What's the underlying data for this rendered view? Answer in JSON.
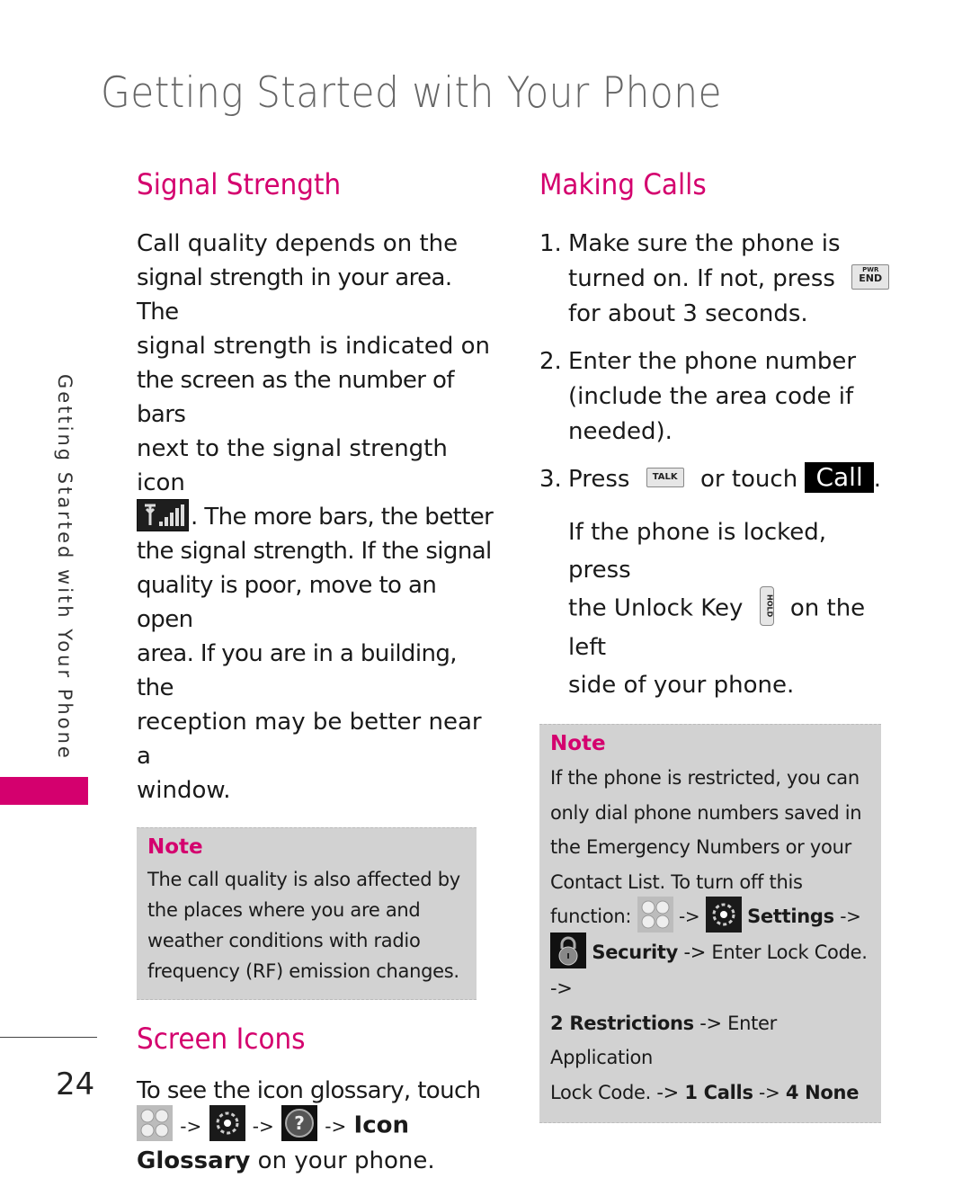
{
  "page": {
    "title": "Getting Started with Your Phone",
    "side_tab": "Getting Started with Your Phone",
    "page_number": "24",
    "accent_color": "#d4006e"
  },
  "signal_strength": {
    "heading": "Signal Strength",
    "lines": [
      "Call quality depends on the",
      "signal strength in your area. The",
      "signal strength is indicated on",
      "the screen as the number of bars",
      "next to the signal strength icon"
    ],
    "icon_line_after": ". The more bars, the better",
    "lines_after": [
      "the signal strength. If the signal",
      "quality is poor, move to an open",
      "area. If you are in a building, the",
      "reception may be better near a",
      "window."
    ],
    "note": {
      "title": "Note",
      "lines": [
        "The call quality is also affected by",
        "the places where you are and",
        "weather conditions with radio",
        "frequency (RF) emission changes."
      ]
    }
  },
  "screen_icons": {
    "heading": "Screen Icons",
    "line1": "To see the icon glossary, touch",
    "arrow": "->",
    "bold_a": "Icon",
    "bold_b": "Glossary",
    "tail": " on your phone."
  },
  "making_calls": {
    "heading": "Making Calls",
    "step1": {
      "num": "1.",
      "line1": "Make sure the phone is",
      "line2": "turned on. If not, press",
      "key_top": "PWR",
      "key_bottom": "END",
      "line3": "for about 3 seconds."
    },
    "step2": {
      "num": "2.",
      "lines": [
        "Enter the phone number",
        "(include the area code if",
        "needed)."
      ]
    },
    "step3": {
      "num": "3.",
      "press": "Press",
      "talk_key": "TALK",
      "or_touch": "or touch",
      "call_button": "Call",
      "period": "."
    },
    "locked": {
      "line1": "If the phone is locked, press",
      "line2a": "the Unlock Key",
      "hold_key": "HOLD",
      "line2b": "on the left",
      "line3": "side of your phone."
    },
    "note": {
      "title": "Note",
      "lines": [
        "If the phone is restricted, you can",
        "only dial phone numbers saved in",
        "the Emergency Numbers or your",
        "Contact List. To turn off this"
      ],
      "function_label": "function:",
      "arrow": "->",
      "settings": "Settings",
      "security": "Security",
      "enter_lock": "-> Enter Lock Code. ->",
      "restrictions": "2 Restrictions",
      "enter_app": "-> Enter Application",
      "lock_code": "Lock Code. ->",
      "calls": "1 Calls",
      "none": "4 None"
    }
  }
}
